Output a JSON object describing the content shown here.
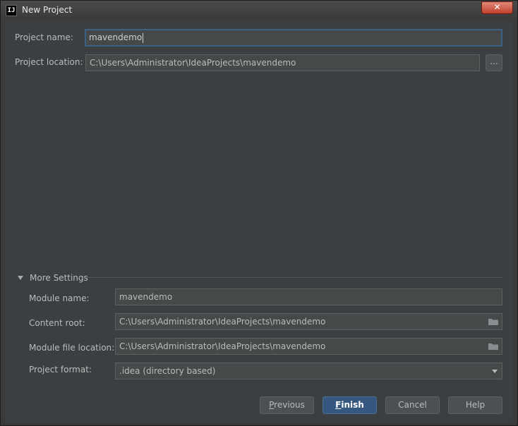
{
  "window": {
    "title": "New Project",
    "app_icon_text": "IJ",
    "close_label": "✕"
  },
  "project": {
    "name_label": "Project name:",
    "name_value": "mavendemo",
    "location_label": "Project location:",
    "location_value": "C:\\Users\\Administrator\\IdeaProjects\\mavendemo",
    "browse_label": "..."
  },
  "more_settings": {
    "title": "More Settings",
    "expanded": true,
    "module_name_label": "Module name:",
    "module_name_value": "mavendemo",
    "content_root_label": "Content root:",
    "content_root_value": "C:\\Users\\Administrator\\IdeaProjects\\mavendemo",
    "module_file_location_label": "Module file location:",
    "module_file_location_value": "C:\\Users\\Administrator\\IdeaProjects\\mavendemo",
    "project_format_label": "Project format:",
    "project_format_value": ".idea (directory based)"
  },
  "buttons": {
    "previous_first": "P",
    "previous_rest": "revious",
    "finish_first": "F",
    "finish_rest": "inish",
    "cancel": "Cancel",
    "help": "Help"
  },
  "colors": {
    "background": "#3c3f41",
    "field": "#45494a",
    "focus_border": "#3d6185",
    "primary_button": "#365880"
  }
}
